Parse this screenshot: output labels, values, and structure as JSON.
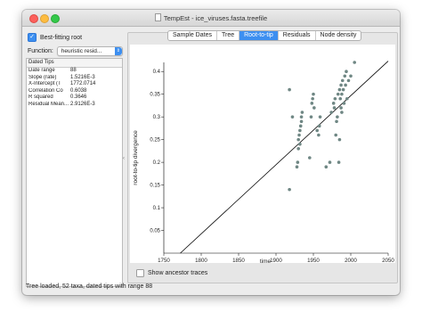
{
  "window": {
    "title": "TempEst - ice_viruses.fasta.treefile"
  },
  "left_panel": {
    "best_fitting_root": {
      "label": "Best-fitting root",
      "checked": true
    },
    "function": {
      "label": "Function:",
      "value": "heuristic resid..."
    },
    "table": {
      "header": "Dated Tips",
      "rows": [
        {
          "key": "Date range",
          "value": "88"
        },
        {
          "key": "Slope (rate)",
          "value": "1.5216E-3"
        },
        {
          "key": "X-Intercept (T",
          "value": "1772.0714"
        },
        {
          "key": "Correlation Co",
          "value": "0.6038"
        },
        {
          "key": "R squared",
          "value": "0.3646"
        },
        {
          "key": "Residual Mean...",
          "value": "2.9126E-3"
        }
      ]
    }
  },
  "tabs": [
    {
      "label": "Sample Dates",
      "active": false
    },
    {
      "label": "Tree",
      "active": false
    },
    {
      "label": "Root-to-tip",
      "active": true
    },
    {
      "label": "Residuals",
      "active": false
    },
    {
      "label": "Node density",
      "active": false
    }
  ],
  "show_ancestor_traces": {
    "label": "Show ancestor traces",
    "checked": false
  },
  "status": "Tree loaded, 52 taxa, dated tips with range 88",
  "colors": {
    "accent": "#3d8ff0",
    "points": "#6f8784",
    "regression_line": "#000000"
  },
  "chart_data": {
    "type": "scatter",
    "xlabel": "time",
    "ylabel": "root-to-tip divergence",
    "xlim": [
      1750,
      2050
    ],
    "ylim": [
      0,
      0.42
    ],
    "x_ticks": [
      1750,
      1800,
      1850,
      1900,
      1950,
      2000,
      2050
    ],
    "y_ticks": [
      0.05,
      0.1,
      0.15,
      0.2,
      0.25,
      0.3,
      0.35,
      0.4
    ],
    "regression_line": {
      "x": [
        1772.07,
        2050
      ],
      "y": [
        0,
        0.4229
      ]
    },
    "series": [
      {
        "x": [
          1918,
          1918,
          1922,
          1928,
          1929,
          1930,
          1930,
          1931,
          1932,
          1932,
          1933,
          1934,
          1934,
          1935,
          1945,
          1947,
          1948,
          1949,
          1950,
          1951,
          1955,
          1957,
          1958,
          1959,
          1967,
          1972,
          1974,
          1977,
          1978,
          1979,
          1980,
          1981,
          1982,
          1983,
          1984,
          1985,
          1985,
          1986,
          1987,
          1987,
          1988,
          1988,
          1989,
          1990,
          1991,
          1992,
          1993,
          1994,
          1995,
          1997,
          2000,
          2005
        ],
        "y": [
          0.36,
          0.14,
          0.3,
          0.19,
          0.2,
          0.23,
          0.25,
          0.26,
          0.24,
          0.27,
          0.28,
          0.29,
          0.3,
          0.31,
          0.21,
          0.3,
          0.33,
          0.34,
          0.35,
          0.32,
          0.27,
          0.26,
          0.28,
          0.3,
          0.19,
          0.2,
          0.31,
          0.33,
          0.32,
          0.34,
          0.26,
          0.29,
          0.3,
          0.35,
          0.2,
          0.25,
          0.36,
          0.34,
          0.32,
          0.37,
          0.35,
          0.31,
          0.38,
          0.36,
          0.33,
          0.39,
          0.37,
          0.4,
          0.34,
          0.38,
          0.39,
          0.42
        ]
      }
    ]
  }
}
